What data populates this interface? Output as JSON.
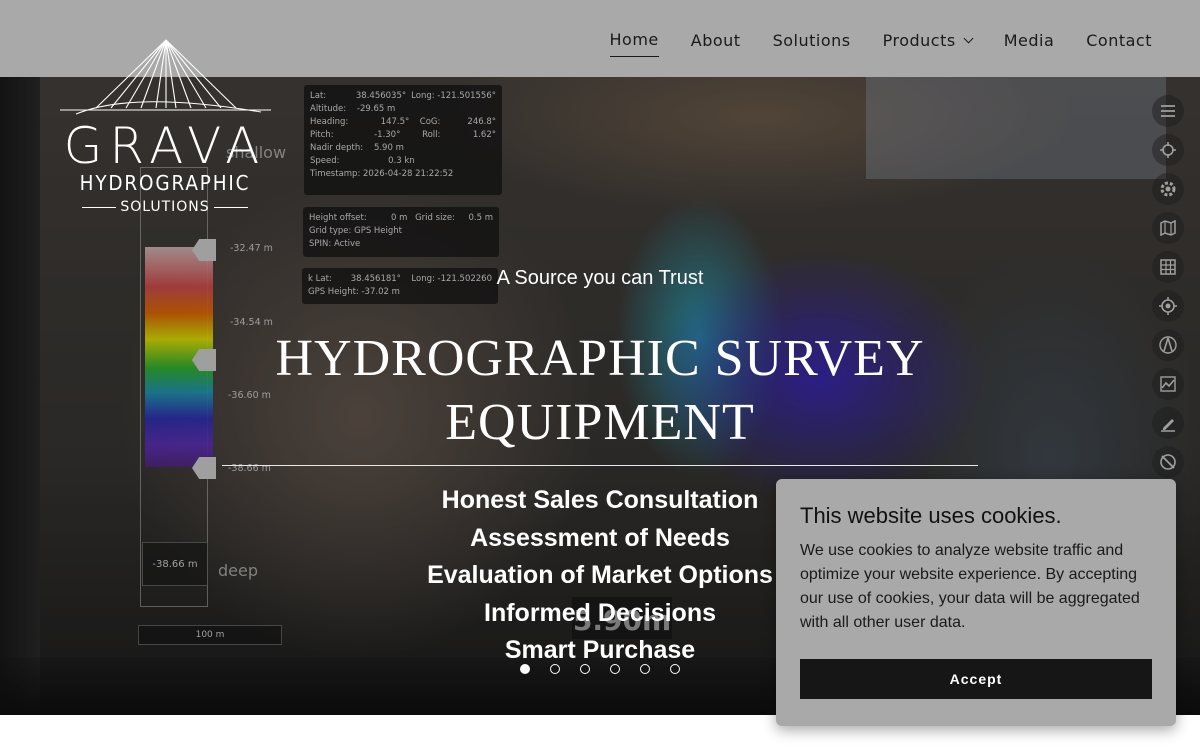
{
  "nav": {
    "items": [
      {
        "label": "Home",
        "active": true
      },
      {
        "label": "About"
      },
      {
        "label": "Solutions"
      },
      {
        "label": "Products",
        "has_dropdown": true
      },
      {
        "label": "Media"
      },
      {
        "label": "Contact"
      }
    ]
  },
  "logo": {
    "title": "GRAVA",
    "subtitle": "HYDROGRAPHIC",
    "subtitle2": "SOLUTIONS"
  },
  "hero": {
    "tagline": "A Source you can Trust",
    "title_line1": "HYDROGRAPHIC SURVEY",
    "title_line2": "EQUIPMENT",
    "bullets": [
      "Honest Sales Consultation",
      "Assessment of Needs",
      "Evaluation of Market Options",
      "Informed Decisions",
      "Smart Purchase"
    ],
    "slides_total": 6,
    "slide_active": 1
  },
  "survey_overlay": {
    "panel1": {
      "lat_label": "Lat:",
      "lat": "38.456035°",
      "long_label": "Long:",
      "long": "-121.501556°",
      "altitude_label": "Altitude:",
      "altitude": "-29.65 m",
      "heading_label": "Heading:",
      "heading": "147.5°",
      "cog_label": "CoG:",
      "cog": "246.8°",
      "pitch_label": "Pitch:",
      "pitch": "-1.30°",
      "roll_label": "Roll:",
      "roll": "1.62°",
      "nadir_label": "Nadir depth:",
      "nadir": "5.90 m",
      "speed_label": "Speed:",
      "speed": "0.3 kn",
      "timestamp_label": "Timestamp:",
      "timestamp": "2026-04-28 21:22:52"
    },
    "panel2": {
      "height_offset_label": "Height offset:",
      "height_offset": "0 m",
      "grid_size_label": "Grid size:",
      "grid_size": "0.5 m",
      "grid_type_label": "Grid type:",
      "grid_type": "GPS Height",
      "spin_label": "SPIN:",
      "spin": "Active"
    },
    "panel3": {
      "lat_label": "Lat:",
      "lat": "38.456181°",
      "long_label": "Long:",
      "long": "-121.502260",
      "gps_height_label": "GPS Height:",
      "gps_height": "-37.02 m"
    },
    "depth_scale": [
      "-32.47 m",
      "-34.54 m",
      "-36.60 m",
      "-38.66 m"
    ],
    "depth_box": "-38.66 m",
    "shallow": "shallow",
    "deep": "deep",
    "scale": "100 m",
    "readout": "5.90m"
  },
  "cookie": {
    "title": "This website uses cookies.",
    "text": "We use cookies to analyze website traffic and optimize your website experience. By accepting our use of cookies, your data will be aggregated with all other user data.",
    "accept_label": "Accept"
  },
  "colors": {
    "header_bg": "#a9a9a9",
    "cookie_bg": "#a9a9a9",
    "accept_bg": "#161616"
  }
}
